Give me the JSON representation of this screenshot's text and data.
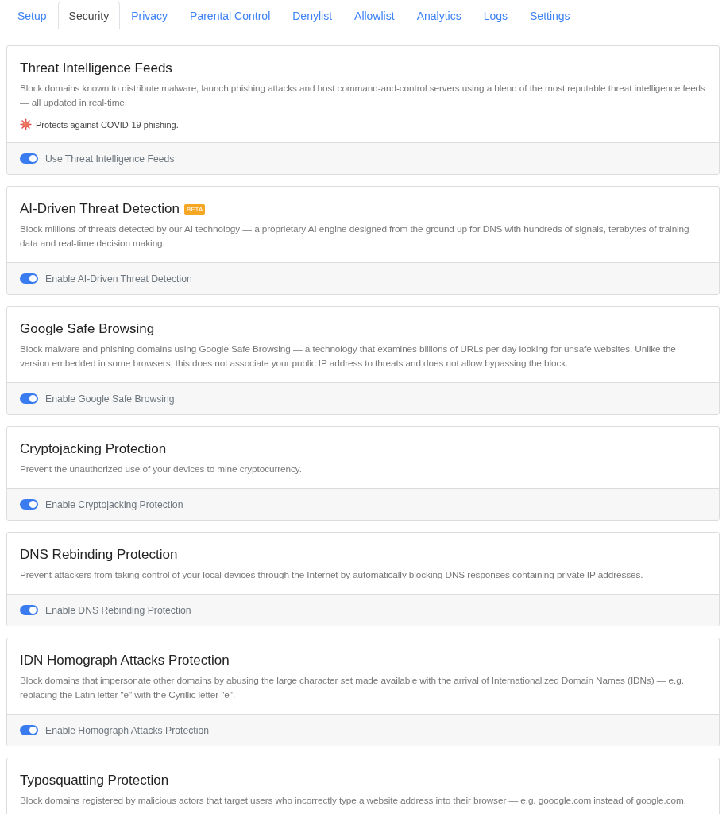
{
  "tabs": [
    {
      "label": "Setup",
      "selected": false
    },
    {
      "label": "Security",
      "selected": true
    },
    {
      "label": "Privacy",
      "selected": false
    },
    {
      "label": "Parental Control",
      "selected": false
    },
    {
      "label": "Denylist",
      "selected": false
    },
    {
      "label": "Allowlist",
      "selected": false
    },
    {
      "label": "Analytics",
      "selected": false
    },
    {
      "label": "Logs",
      "selected": false
    },
    {
      "label": "Settings",
      "selected": false
    }
  ],
  "cards": [
    {
      "title": "Threat Intelligence Feeds",
      "description": "Block domains known to distribute malware, launch phishing attacks and host command-and-control servers using a blend of the most reputable threat intelligence feeds — all updated in real-time.",
      "note": "Protects against COVID-19 phishing.",
      "toggle": {
        "label": "Use Threat Intelligence Feeds",
        "on": true
      }
    },
    {
      "title": "AI-Driven Threat Detection",
      "badge": "BETA",
      "description": "Block millions of threats detected by our AI technology — a proprietary AI engine designed from the ground up for DNS with hundreds of signals, terabytes of training data and real-time decision making.",
      "toggle": {
        "label": "Enable AI-Driven Threat Detection",
        "on": true
      }
    },
    {
      "title": "Google Safe Browsing",
      "description": "Block malware and phishing domains using Google Safe Browsing — a technology that examines billions of URLs per day looking for unsafe websites. Unlike the version embedded in some browsers, this does not associate your public IP address to threats and does not allow bypassing the block.",
      "toggle": {
        "label": "Enable Google Safe Browsing",
        "on": true
      }
    },
    {
      "title": "Cryptojacking Protection",
      "description": "Prevent the unauthorized use of your devices to mine cryptocurrency.",
      "toggle": {
        "label": "Enable Cryptojacking Protection",
        "on": true
      }
    },
    {
      "title": "DNS Rebinding Protection",
      "description": "Prevent attackers from taking control of your local devices through the Internet by automatically blocking DNS responses containing private IP addresses.",
      "toggle": {
        "label": "Enable DNS Rebinding Protection",
        "on": true
      }
    },
    {
      "title": "IDN Homograph Attacks Protection",
      "description": "Block domains that impersonate other domains by abusing the large character set made available with the arrival of Internationalized Domain Names (IDNs) — e.g. replacing the Latin letter \"e\" with the Cyrillic letter \"е\".",
      "toggle": {
        "label": "Enable Homograph Attacks Protection",
        "on": true
      }
    },
    {
      "title": "Typosquatting Protection",
      "description": "Block domains registered by malicious actors that target users who incorrectly type a website address into their browser — e.g. gooogle.com instead of google.com."
    }
  ]
}
